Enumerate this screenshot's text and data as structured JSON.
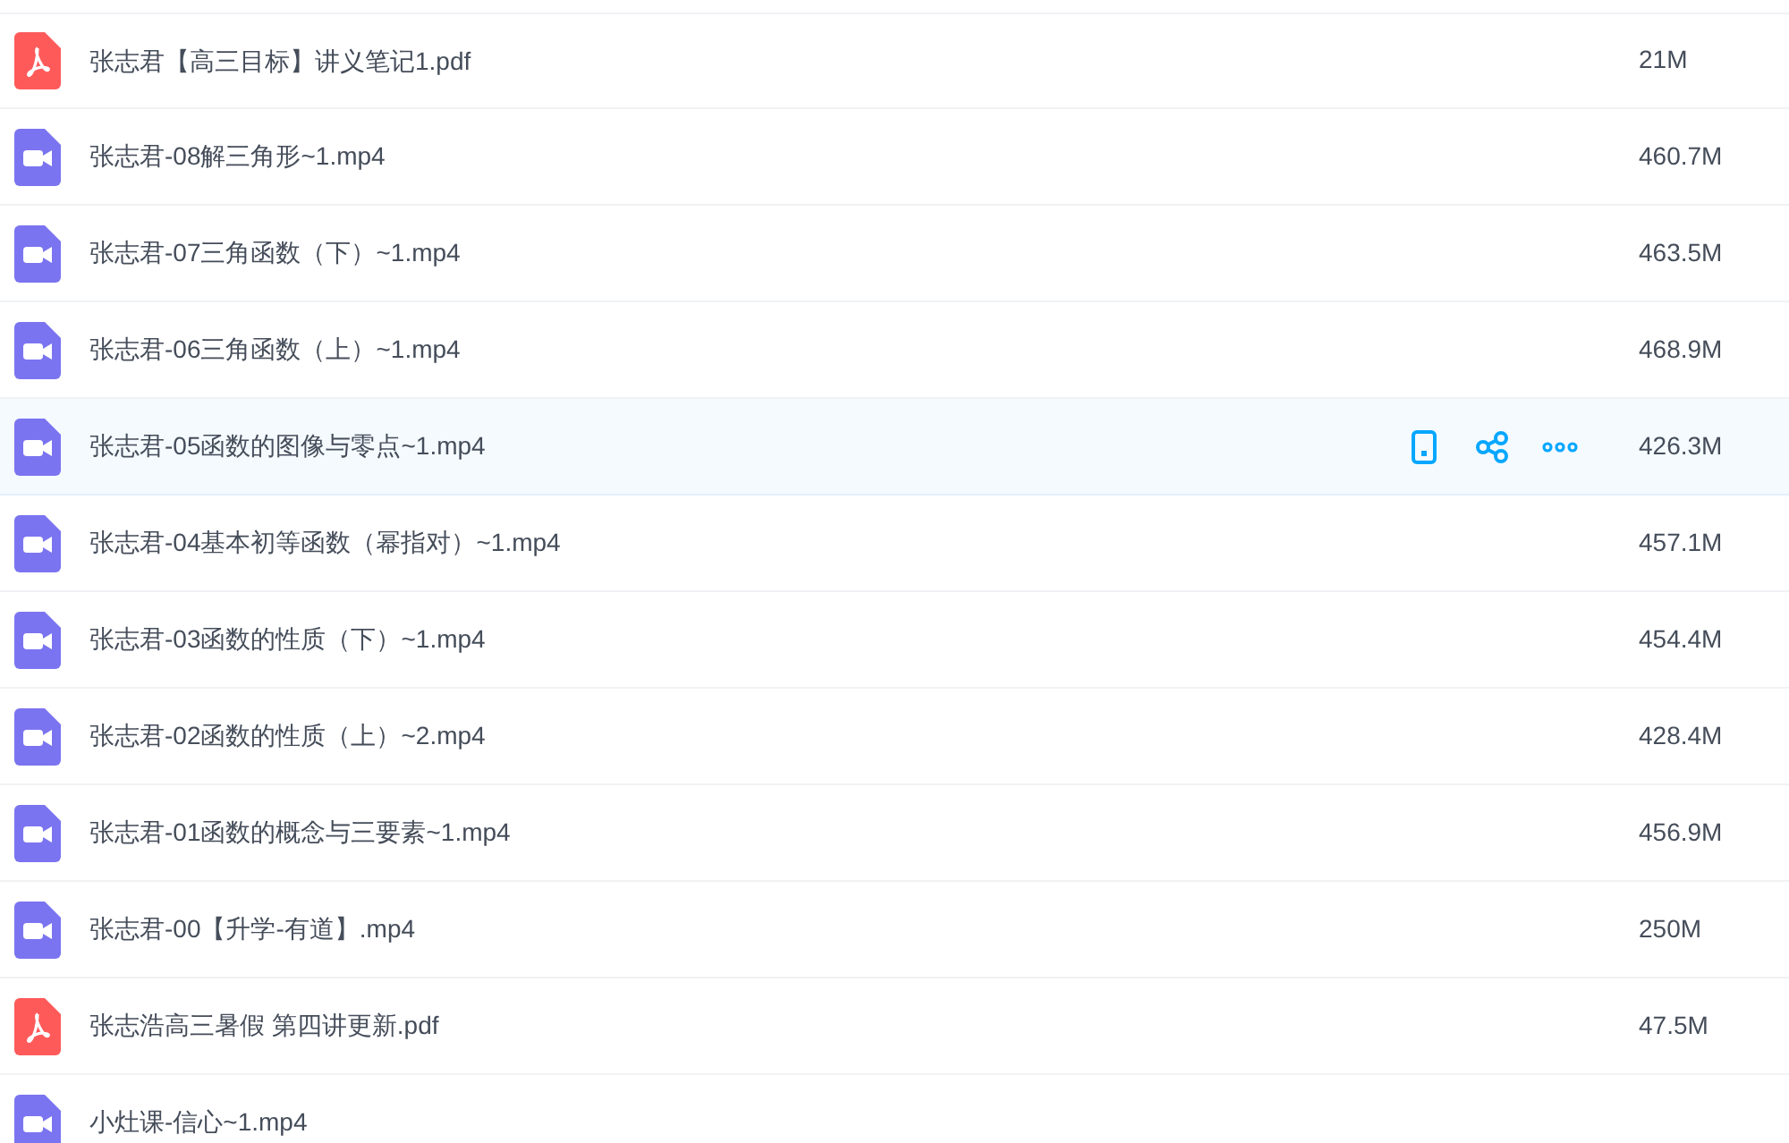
{
  "files": [
    {
      "kind": "pdf",
      "name": "张志君【高三目标】讲义笔记1.pdf",
      "size": "21M",
      "hovered": false
    },
    {
      "kind": "video",
      "name": "张志君-08解三角形~1.mp4",
      "size": "460.7M",
      "hovered": false
    },
    {
      "kind": "video",
      "name": "张志君-07三角函数（下）~1.mp4",
      "size": "463.5M",
      "hovered": false
    },
    {
      "kind": "video",
      "name": "张志君-06三角函数（上）~1.mp4",
      "size": "468.9M",
      "hovered": false
    },
    {
      "kind": "video",
      "name": "张志君-05函数的图像与零点~1.mp4",
      "size": "426.3M",
      "hovered": true
    },
    {
      "kind": "video",
      "name": "张志君-04基本初等函数（幂指对）~1.mp4",
      "size": "457.1M",
      "hovered": false
    },
    {
      "kind": "video",
      "name": "张志君-03函数的性质（下）~1.mp4",
      "size": "454.4M",
      "hovered": false
    },
    {
      "kind": "video",
      "name": "张志君-02函数的性质（上）~2.mp4",
      "size": "428.4M",
      "hovered": false
    },
    {
      "kind": "video",
      "name": "张志君-01函数的概念与三要素~1.mp4",
      "size": "456.9M",
      "hovered": false
    },
    {
      "kind": "video",
      "name": "张志君-00【升学-有道】.mp4",
      "size": "250M",
      "hovered": false
    },
    {
      "kind": "pdf",
      "name": "张志浩高三暑假 第四讲更新.pdf",
      "size": "47.5M",
      "hovered": false
    },
    {
      "kind": "video",
      "name": "小灶课-信心~1.mp4",
      "hovered": false
    }
  ]
}
